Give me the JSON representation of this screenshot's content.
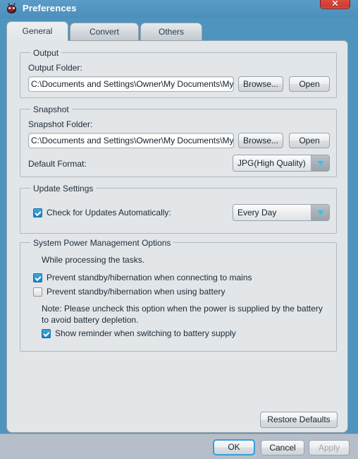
{
  "window": {
    "title": "Preferences",
    "app_icon": "bug-icon",
    "close_label": "✕",
    "accent_blue": "#4f93bf",
    "panel_bg": "#e2e6e9",
    "footer_bg": "#b6bfc9",
    "close_red": "#d9443a",
    "checkbox_blue": "#1d84c4",
    "arrow_cyan": "#2fc3f2",
    "focus_blue": "#2f9fd8"
  },
  "tabs": [
    {
      "label": "General",
      "active": true
    },
    {
      "label": "Convert",
      "active": false
    },
    {
      "label": "Others",
      "active": false
    }
  ],
  "output_group": {
    "legend": "Output",
    "folder_label": "Output Folder:",
    "folder_value": "C:\\Documents and Settings\\Owner\\My Documents\\My Vid",
    "browse_label": "Browse...",
    "open_label": "Open"
  },
  "snapshot_group": {
    "legend": "Snapshot",
    "folder_label": "Snapshot Folder:",
    "folder_value": "C:\\Documents and Settings\\Owner\\My Documents\\My Pic",
    "browse_label": "Browse...",
    "open_label": "Open",
    "format_label": "Default Format:",
    "format_value": "JPG(High Quality)"
  },
  "update_group": {
    "legend": "Update Settings",
    "check_updates_label": "Check for Updates Automatically:",
    "check_updates_checked": true,
    "frequency_value": "Every Day"
  },
  "power_group": {
    "legend": "System Power Management Options",
    "intro_text": "While processing the tasks.",
    "prevent_mains_label": "Prevent standby/hibernation when connecting to mains",
    "prevent_mains_checked": true,
    "prevent_battery_label": "Prevent standby/hibernation when using battery",
    "prevent_battery_checked": false,
    "note_text": "Note: Please uncheck this option when the power is supplied by the battery to avoid battery depletion.",
    "show_reminder_label": "Show reminder when switching to battery supply",
    "show_reminder_checked": true
  },
  "panel_actions": {
    "restore_defaults_label": "Restore Defaults"
  },
  "footer": {
    "ok_label": "OK",
    "cancel_label": "Cancel",
    "apply_label": "Apply",
    "apply_disabled": true
  }
}
